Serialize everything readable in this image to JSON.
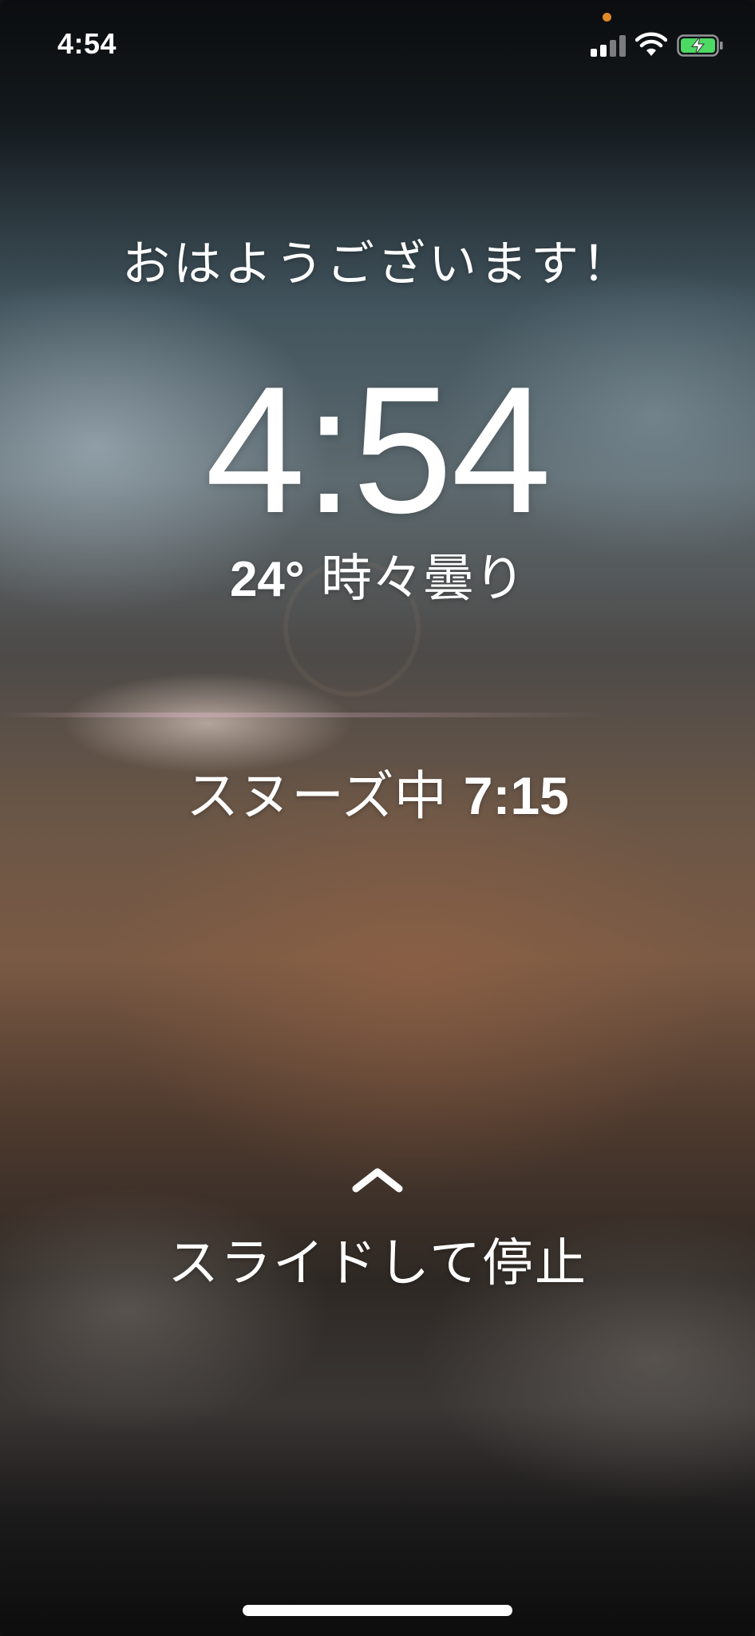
{
  "status_bar": {
    "time": "4:54",
    "icons": [
      "cellular-signal-icon",
      "wifi-icon",
      "battery-charging-icon"
    ],
    "privacy_indicator_color": "#e08a2a",
    "battery_color": "#4cd964"
  },
  "alarm": {
    "greeting": "おはようございます！",
    "time": "4:54",
    "weather": {
      "temperature": "24°",
      "condition": "時々曇り"
    },
    "snooze": {
      "label": "スヌーズ中",
      "time": "7:15"
    }
  },
  "slider": {
    "icon": "chevron-up-icon",
    "label": "スライドして停止"
  }
}
